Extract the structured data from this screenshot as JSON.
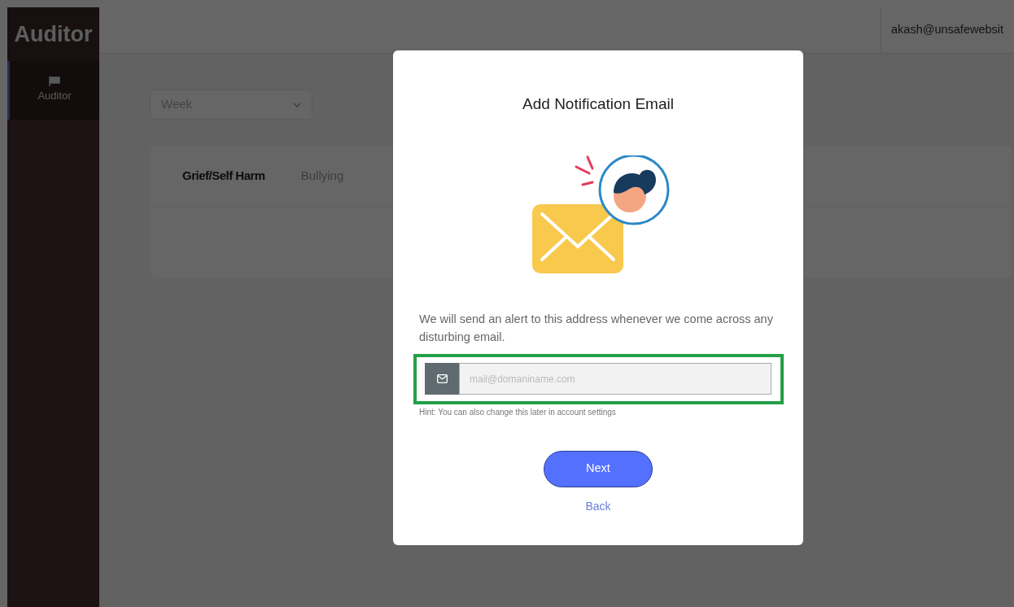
{
  "sidebar": {
    "logo": "Auditor",
    "items": [
      {
        "label": "Auditor",
        "selected": true
      }
    ]
  },
  "header": {
    "user": "akash@unsafewebsit"
  },
  "filter": {
    "value": "Week"
  },
  "tabs": [
    {
      "label": "Grief/Self Harm",
      "selected": true
    },
    {
      "label": "Bullying",
      "selected": false
    }
  ],
  "modal": {
    "title": "Add Notification Email",
    "description": "We will send an alert to this address whenever we come across any disturbing email.",
    "email_field": {
      "placeholder": "mail@domaniname.com",
      "highlighted": true
    },
    "hint": "Hint: You can also change this later in account settings",
    "primary_button": "Next",
    "back_link": "Back"
  }
}
